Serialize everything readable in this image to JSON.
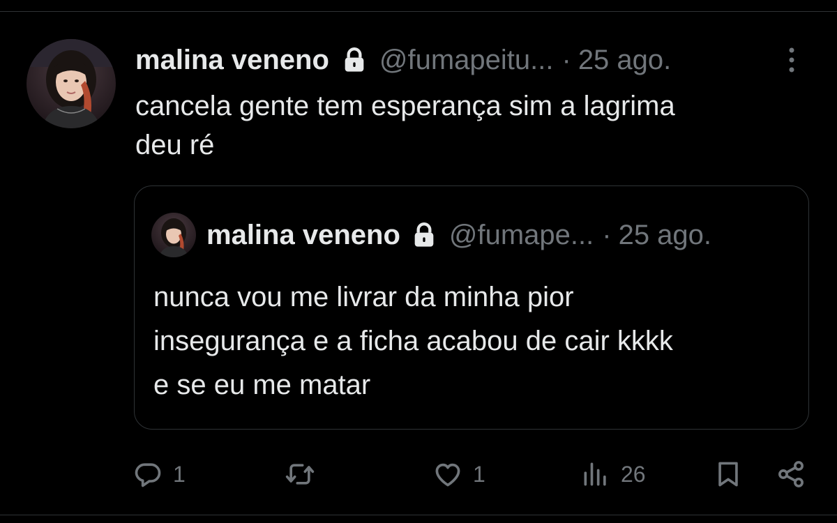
{
  "tweet": {
    "author_name": "malina veneno",
    "handle": "@fumapeitu...",
    "separator": "·",
    "date": "25 ago.",
    "text": "cancela gente tem esperança sim a lagrima\ndeu ré"
  },
  "quoted_tweet": {
    "author_name": "malina veneno",
    "handle": "@fumape...",
    "separator": "·",
    "date": "25 ago.",
    "text": "nunca vou me livrar da minha pior\ninsegurança e a ficha acabou de cair kkkk\ne se eu me matar"
  },
  "actions": {
    "reply_count": "1",
    "retweet_count": "",
    "like_count": "1",
    "views_count": "26"
  },
  "icons": {
    "lock": "lock-icon",
    "more": "more-vertical-icon",
    "reply": "reply-icon",
    "retweet": "retweet-icon",
    "like": "heart-icon",
    "views": "views-chart-icon",
    "bookmark": "bookmark-icon",
    "share": "share-icon"
  },
  "colors": {
    "background": "#000000",
    "text_primary": "#e7e9ea",
    "text_secondary": "#71767b",
    "border": "#2f3336"
  }
}
